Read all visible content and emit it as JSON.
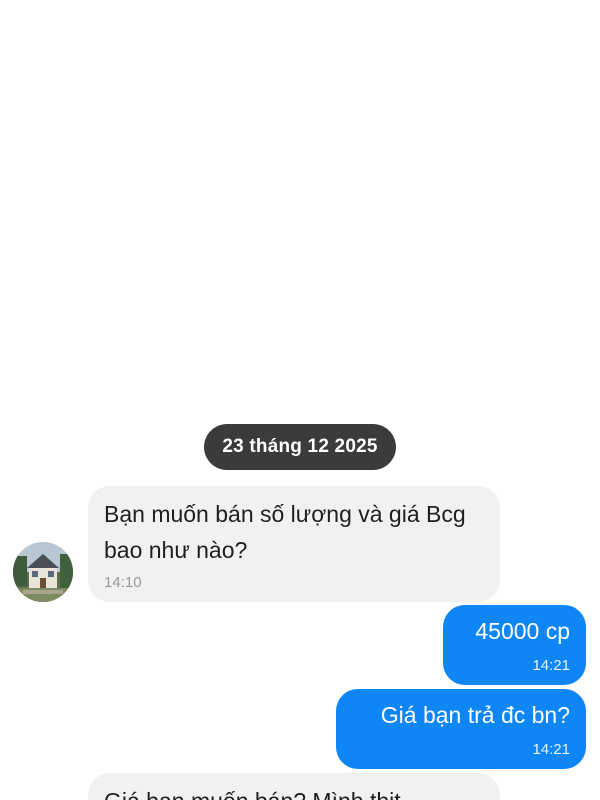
{
  "conversation": {
    "date_separator": "23 tháng 12 2025",
    "messages": [
      {
        "direction": "incoming",
        "text": "Bạn muốn bán số lượng và giá Bcg bao như nào?",
        "time": "14:10"
      },
      {
        "direction": "outgoing",
        "text": "45000 cp",
        "time": "14:21"
      },
      {
        "direction": "outgoing",
        "text": "Giá bạn trả đc bn?",
        "time": "14:21"
      },
      {
        "direction": "incoming",
        "text": "Giá bạn muốn bán? Mình thịt",
        "time": ""
      }
    ]
  },
  "colors": {
    "incoming_bubble": "#f1f1f1",
    "outgoing_bubble": "#0f86f5",
    "date_pill": "#3b3b3b"
  },
  "icons": {
    "contact_avatar": "contact-avatar-house-photo"
  }
}
